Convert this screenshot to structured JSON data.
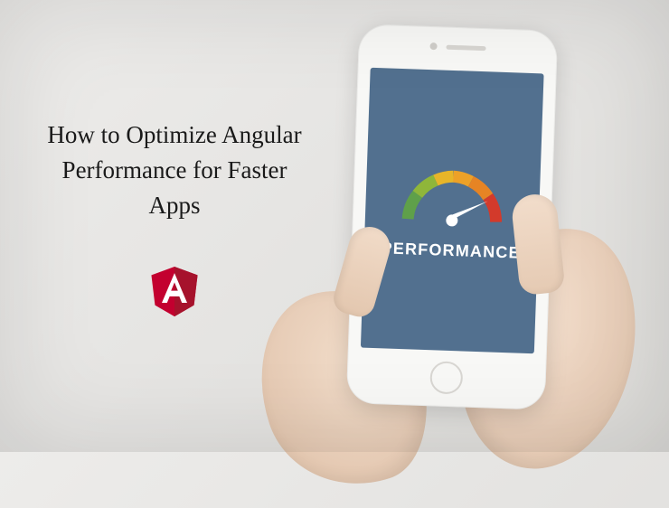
{
  "title": {
    "line1": "How to Optimize Angular",
    "line2": "Performance for Faster",
    "line3": "Apps"
  },
  "phone": {
    "screen_label": "PERFORMANCE"
  },
  "colors": {
    "screen_bg": "#52708f",
    "angular_red": "#c3002f",
    "angular_dark": "#a6122c",
    "gauge_green": "#5fa04a",
    "gauge_yellow": "#e7b529",
    "gauge_orange": "#e68424",
    "gauge_red": "#d33a2b"
  }
}
